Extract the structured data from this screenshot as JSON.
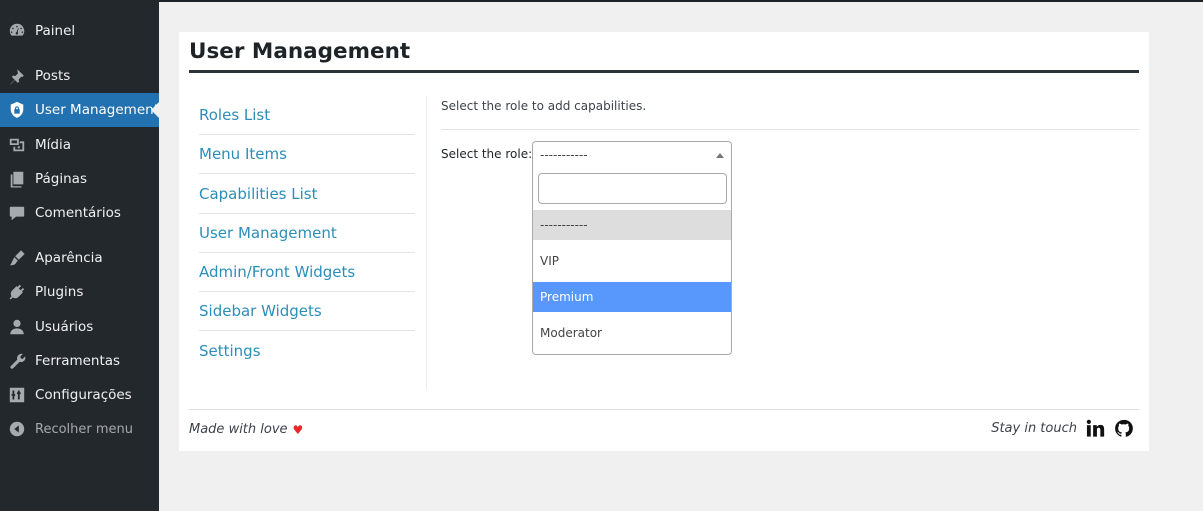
{
  "sidebar": {
    "items": [
      {
        "label": "Painel",
        "icon": "dashboard-icon"
      },
      {
        "label": "Posts",
        "icon": "pin-icon"
      },
      {
        "label": "User Management",
        "icon": "shield-icon"
      },
      {
        "label": "Mídia",
        "icon": "media-icon"
      },
      {
        "label": "Páginas",
        "icon": "page-icon"
      },
      {
        "label": "Comentários",
        "icon": "comment-icon"
      },
      {
        "label": "Aparência",
        "icon": "brush-icon"
      },
      {
        "label": "Plugins",
        "icon": "plugin-icon"
      },
      {
        "label": "Usuários",
        "icon": "user-icon"
      },
      {
        "label": "Ferramentas",
        "icon": "wrench-icon"
      },
      {
        "label": "Configurações",
        "icon": "settings-icon"
      },
      {
        "label": "Recolher menu",
        "icon": "collapse-icon"
      }
    ]
  },
  "card": {
    "title": "User Management",
    "nav": [
      "Roles List",
      "Menu Items",
      "Capabilities List",
      "User Management",
      "Admin/Front Widgets",
      "Sidebar Widgets",
      "Settings"
    ],
    "hint": "Select the role to add capabilities.",
    "role_label": "Select the role:",
    "select": {
      "value": "-----------",
      "options": [
        "-----------",
        "VIP",
        "Premium",
        "Moderator"
      ],
      "selected_index": 0,
      "highlighted_index": 2
    }
  },
  "footer": {
    "left_text": "Made with love",
    "heart": "♥",
    "right_text": "Stay in touch",
    "icons": [
      "linkedin-icon",
      "github-icon"
    ]
  },
  "colors": {
    "sidebar_bg": "#23282d",
    "sidebar_active": "#2271b1",
    "link": "#2c8eb8",
    "option_highlight": "#5897fb",
    "heart": "#e32b2b"
  }
}
